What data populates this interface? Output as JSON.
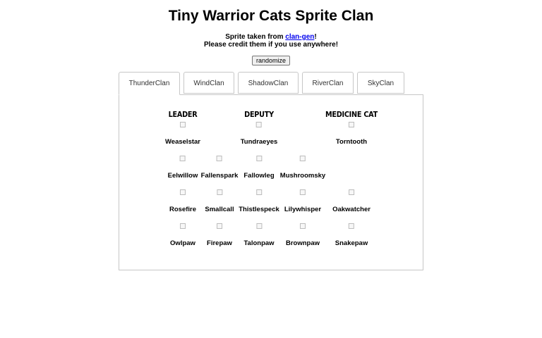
{
  "title": "Tiny Warrior Cats Sprite Clan",
  "credit": {
    "prefix": "Sprite taken from ",
    "link_text": "clan-gen",
    "suffix": "!",
    "line2": "Please credit them if you use anywhere!"
  },
  "randomize_label": "randomize",
  "tabs": [
    {
      "label": "ThunderClan",
      "active": true
    },
    {
      "label": "WindClan",
      "active": false
    },
    {
      "label": "ShadowClan",
      "active": false
    },
    {
      "label": "RiverClan",
      "active": false
    },
    {
      "label": "SkyClan",
      "active": false
    }
  ],
  "roles": {
    "leader": "LEADER",
    "deputy": "DEPUTY",
    "medicine": "MEDICINE CAT"
  },
  "cats": {
    "leader": "Weaselstar",
    "deputy": "Tundraeyes",
    "medicine": "Torntooth",
    "row2": [
      "Eelwillow",
      "Fallenspark",
      "Fallowleg",
      "Mushroomsky"
    ],
    "row3": [
      "Rosefire",
      "Smallcall",
      "Thistlespeck",
      "Lilywhisper",
      "Oakwatcher"
    ],
    "row4": [
      "Owlpaw",
      "Firepaw",
      "Talonpaw",
      "Brownpaw",
      "Snakepaw"
    ]
  }
}
